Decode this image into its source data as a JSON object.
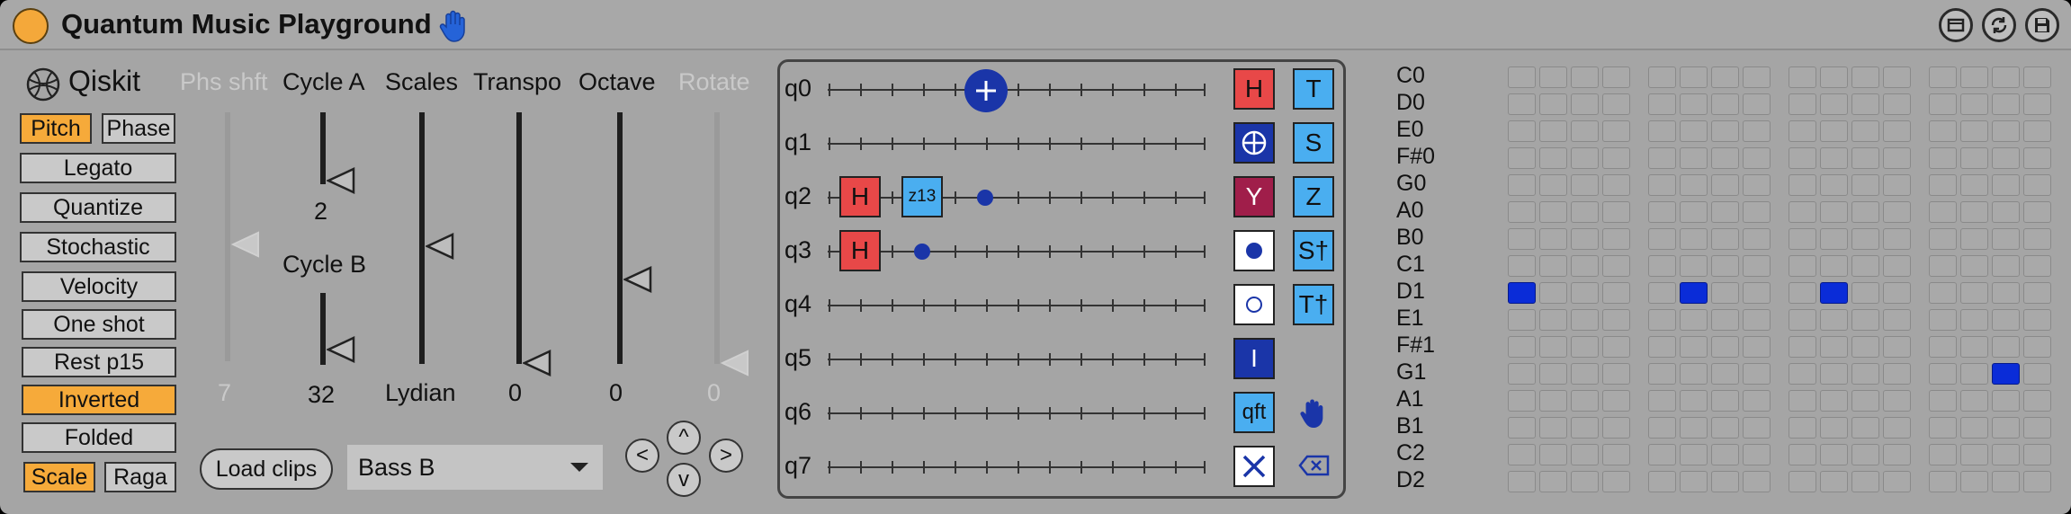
{
  "title": "Quantum Music Playground",
  "header_buttons": [
    "window-icon",
    "refresh-icon",
    "save-icon"
  ],
  "logo": "Qiskit",
  "toggles": {
    "pitch": "Pitch",
    "phase": "Phase",
    "legato": "Legato",
    "quantize": "Quantize",
    "stochastic": "Stochastic",
    "velocity": "Velocity",
    "one_shot": "One shot",
    "rest_p15": "Rest p15",
    "inverted": "Inverted",
    "folded": "Folded",
    "scale": "Scale",
    "raga": "Raga"
  },
  "sliders": {
    "phs_shft": {
      "label": "Phs shft",
      "value": "7",
      "level": 0.5
    },
    "cycle_a": {
      "label": "Cycle A",
      "value": "2",
      "level": 0.0
    },
    "cycle_b": {
      "label": "Cycle B",
      "value": "32",
      "level": 0.0
    },
    "scales": {
      "label": "Scales",
      "value": "Lydian",
      "level": 0.52
    },
    "transpo": {
      "label": "Transpo",
      "value": "0",
      "level": 0.0
    },
    "octave": {
      "label": "Octave",
      "value": "0",
      "level": 0.34
    },
    "rotate": {
      "label": "Rotate",
      "value": "0",
      "level": 0.0
    }
  },
  "load_clips": "Load clips",
  "clip_select": {
    "value": "Bass B"
  },
  "nav": {
    "up": "^",
    "left": "<",
    "right": ">",
    "down": "v"
  },
  "qubits": [
    "q0",
    "q1",
    "q2",
    "q3",
    "q4",
    "q5",
    "q6",
    "q7"
  ],
  "circuit": {
    "h": "H",
    "z13": "z13"
  },
  "palette": {
    "h": "H",
    "t": "T",
    "s": "S",
    "y": "Y",
    "z": "Z",
    "sdg": "S†",
    "tdg": "T†",
    "i": "I",
    "qft": "qft"
  },
  "notes": [
    "C0",
    "D0",
    "E0",
    "F#0",
    "G0",
    "A0",
    "B0",
    "C1",
    "D1",
    "E1",
    "F#1",
    "G1",
    "A1",
    "B1",
    "C2",
    "D2"
  ],
  "grid": {
    "columns": 16,
    "active": [
      {
        "row": 8,
        "col": 0
      },
      {
        "row": 8,
        "col": 5
      },
      {
        "row": 8,
        "col": 9
      },
      {
        "row": 11,
        "col": 14
      }
    ]
  },
  "colors": {
    "accent": "#f6aa3a",
    "panel": "#a5a5a5",
    "gate_red": "#e84848",
    "gate_blue": "#4aaef0",
    "gate_navy": "#1a35a8",
    "gate_maroon": "#a01e4a",
    "active_cell": "#0a2cd8"
  }
}
